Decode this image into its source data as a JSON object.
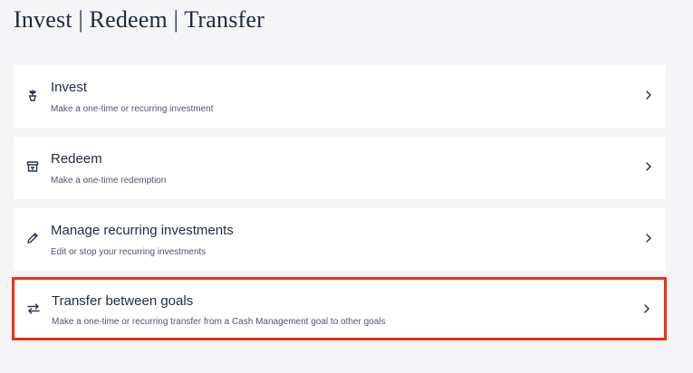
{
  "page": {
    "title": "Invest | Redeem | Transfer"
  },
  "options": [
    {
      "title": "Invest",
      "subtitle": "Make a one-time or recurring investment",
      "icon": "plant-pot-icon"
    },
    {
      "title": "Redeem",
      "subtitle": "Make a one-time redemption",
      "icon": "archive-box-icon"
    },
    {
      "title": "Manage recurring investments",
      "subtitle": "Edit or stop your recurring investments",
      "icon": "pencil-icon"
    },
    {
      "title": "Transfer between goals",
      "subtitle": "Make a one-time or recurring transfer from a Cash Management goal to other goals",
      "icon": "swap-arrows-icon",
      "highlighted": true
    }
  ],
  "colors": {
    "background": "#f5f5f7",
    "card": "#ffffff",
    "text": "#1f2a44",
    "highlight": "#f22d14"
  }
}
